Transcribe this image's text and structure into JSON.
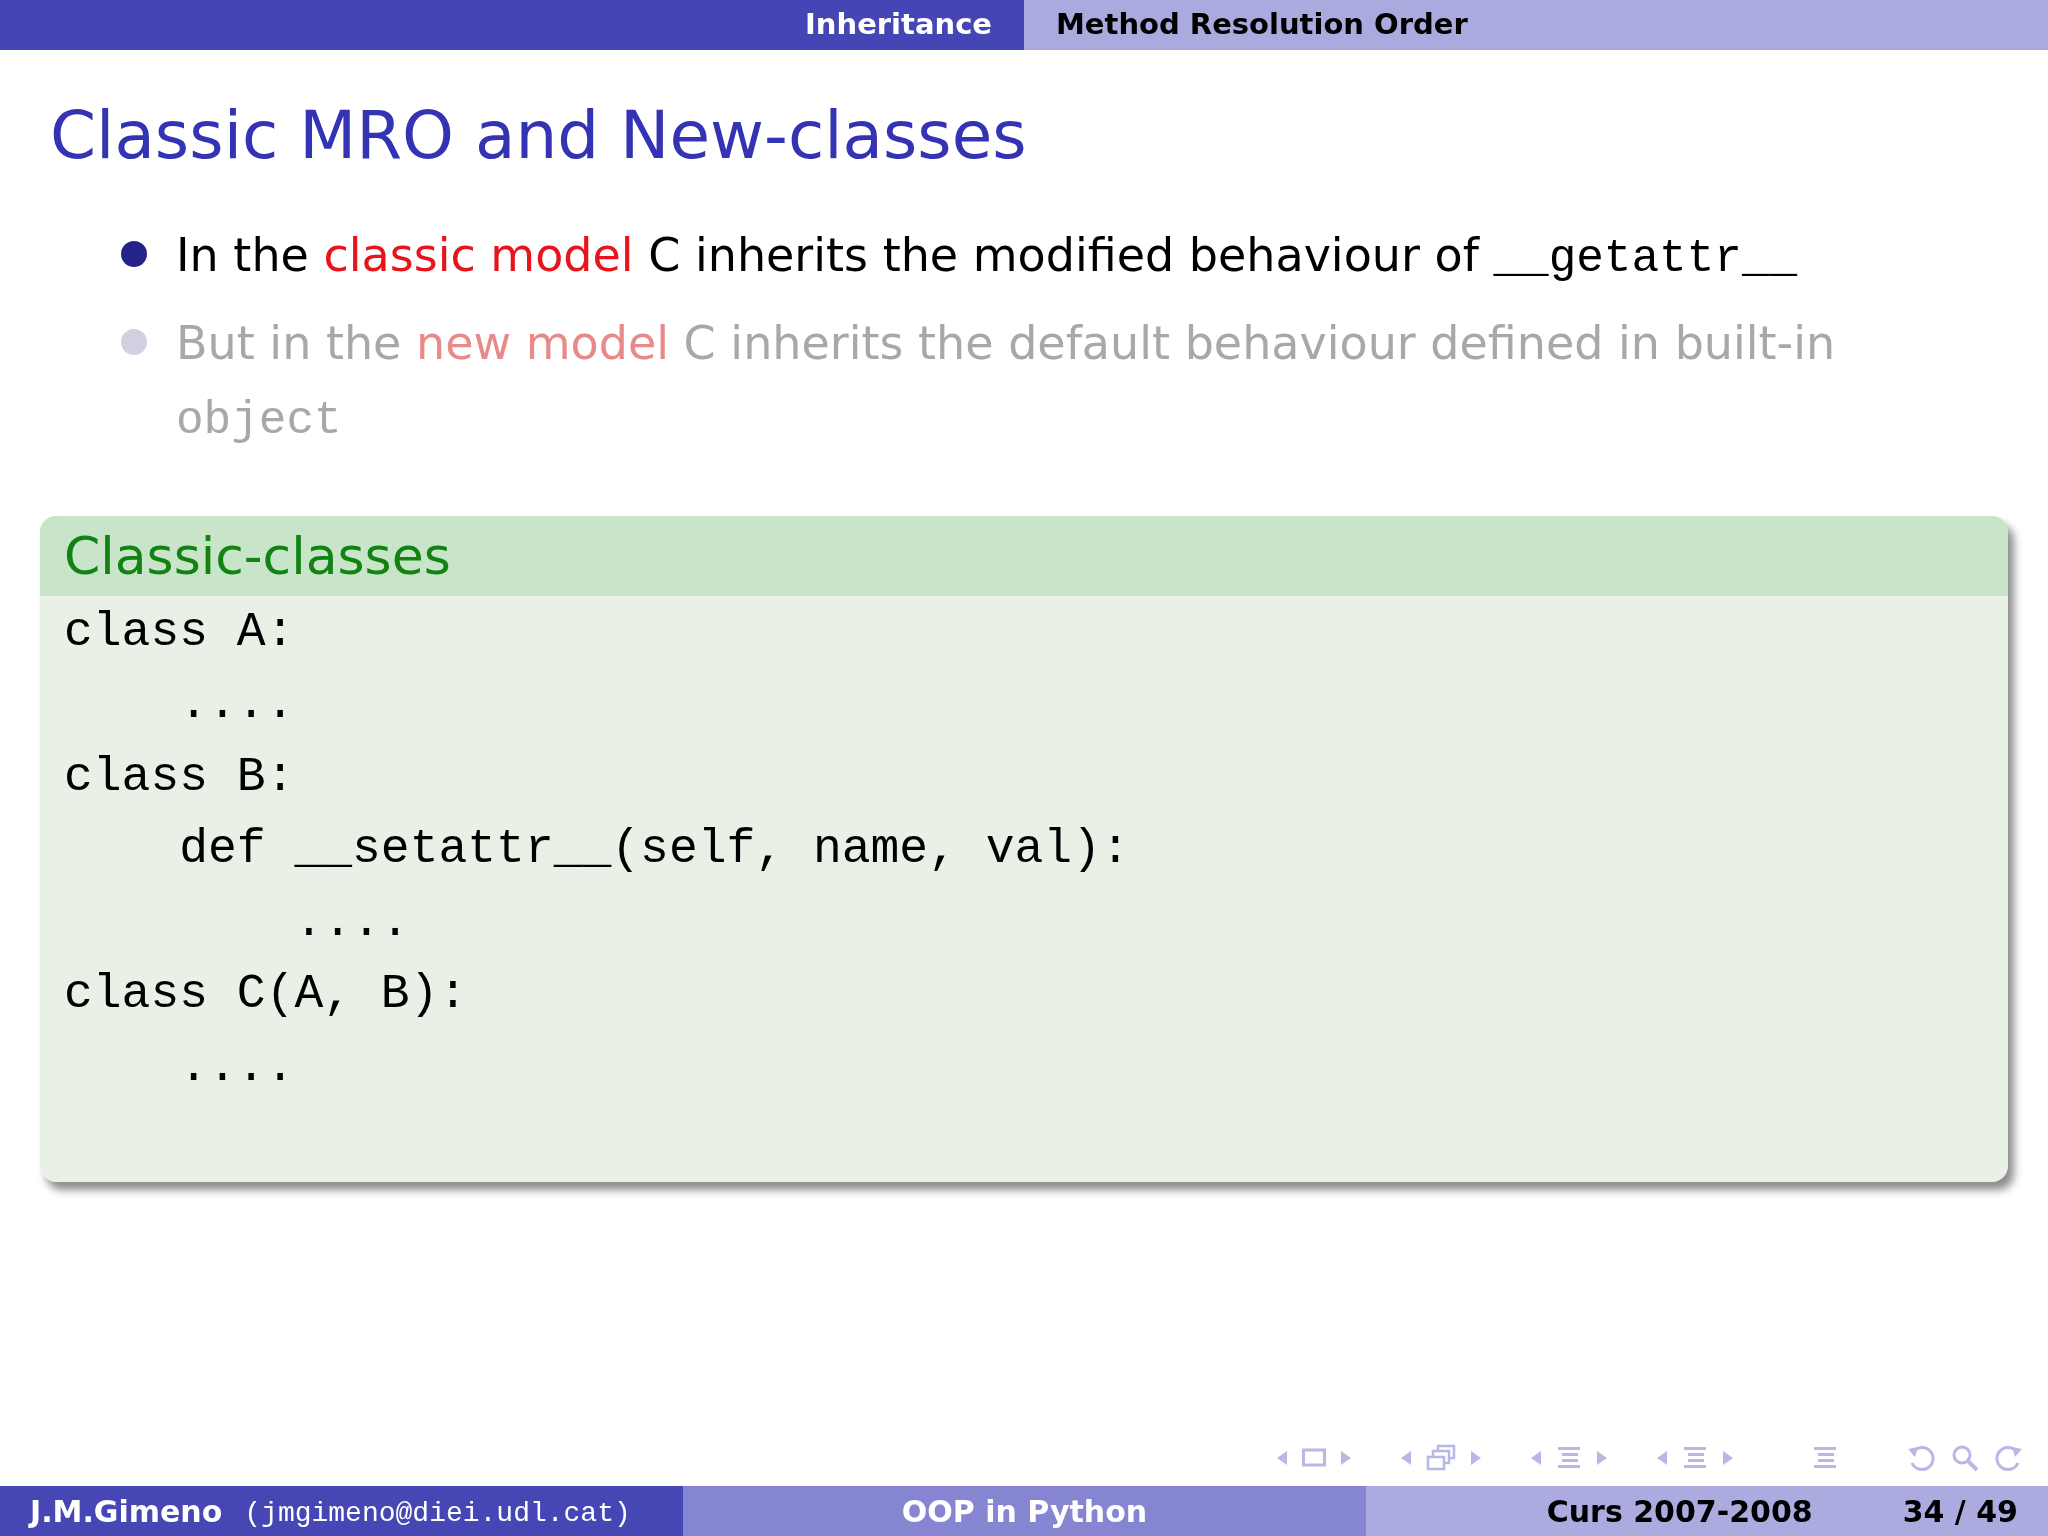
{
  "header": {
    "sections": [
      {
        "label": "Inheritance",
        "selected": false
      },
      {
        "label": "Method Resolution Order",
        "selected": true
      }
    ]
  },
  "title": "Classic MRO and New-classes",
  "bullets": [
    {
      "dimmed": false,
      "segments": [
        {
          "kind": "text",
          "text": "In the "
        },
        {
          "kind": "highlight",
          "text": "classic model"
        },
        {
          "kind": "text",
          "text": " C inherits the modified behaviour of "
        },
        {
          "kind": "code",
          "text": "__getattr__"
        }
      ]
    },
    {
      "dimmed": true,
      "segments": [
        {
          "kind": "text",
          "text": "But in the "
        },
        {
          "kind": "highlight",
          "text": "new model"
        },
        {
          "kind": "text",
          "text": " C inherits the default behaviour defined in built-in "
        },
        {
          "kind": "code",
          "text": "object"
        }
      ]
    }
  ],
  "block": {
    "title": "Classic-classes",
    "code_lines": [
      "class A:",
      "    ....",
      "class B:",
      "    def __setattr__(self, name, val):",
      "        ....",
      "class C(A, B):",
      "    ...."
    ]
  },
  "footer": {
    "author": "J.M.Gimeno",
    "email": "(jmgimeno@diei.udl.cat)",
    "title": "OOP in Python",
    "course": "Curs 2007-2008",
    "page": "34 / 49"
  }
}
